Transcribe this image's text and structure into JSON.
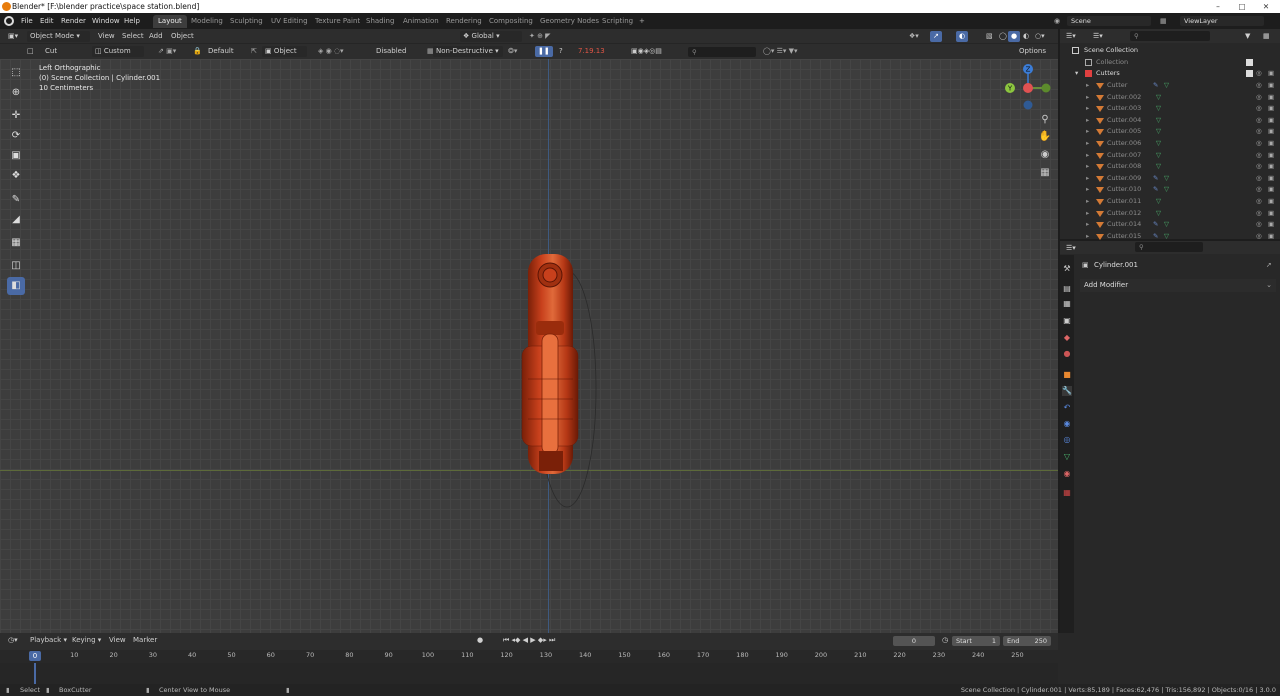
{
  "titlebar": {
    "title": "Blender* [F:\\blender practice\\space station.blend]"
  },
  "topbar": {
    "menus": [
      "File",
      "Edit",
      "Render",
      "Window",
      "Help"
    ],
    "workspaces": [
      "Layout",
      "Modeling",
      "Sculpting",
      "UV Editing",
      "Texture Paint",
      "Shading",
      "Animation",
      "Rendering",
      "Compositing",
      "Geometry Nodes",
      "Scripting"
    ],
    "active_workspace": "Layout",
    "scene": "Scene",
    "view_layer": "ViewLayer"
  },
  "viewport_header": {
    "mode": "Object Mode",
    "menus": [
      "View",
      "Select",
      "Add",
      "Object"
    ],
    "orientation": "Global"
  },
  "tool_header": {
    "tool": "Cut",
    "shape": "Custom",
    "default_label": "Default",
    "object_label": "Object",
    "disabled_label": "Disabled",
    "nondestructive": "Non-Destructive",
    "version": "7.19.13",
    "options": "Options"
  },
  "viewport": {
    "view_name": "Left Orthographic",
    "collection": "(0) Scene Collection | Cylinder.001",
    "units": "10 Centimeters",
    "gizmo": {
      "x_label": "Y",
      "z_label": "Z"
    }
  },
  "outliner": {
    "root": "Scene Collection",
    "collection": "Collection",
    "cutters": "Cutters",
    "items": [
      "Cutter",
      "Cutter.002",
      "Cutter.003",
      "Cutter.004",
      "Cutter.005",
      "Cutter.006",
      "Cutter.007",
      "Cutter.008",
      "Cutter.009",
      "Cutter.010",
      "Cutter.011",
      "Cutter.012",
      "Cutter.014",
      "Cutter.015"
    ]
  },
  "properties": {
    "object": "Cylinder.001",
    "add_modifier": "Add Modifier"
  },
  "timeline": {
    "menus": [
      "Playback",
      "Keying",
      "View",
      "Marker"
    ],
    "current_frame": "0",
    "start_label": "Start",
    "start": "1",
    "end_label": "End",
    "end": "250",
    "ticks": [
      "0",
      "10",
      "20",
      "30",
      "40",
      "50",
      "60",
      "70",
      "80",
      "90",
      "100",
      "110",
      "120",
      "130",
      "140",
      "150",
      "160",
      "170",
      "180",
      "190",
      "200",
      "210",
      "220",
      "230",
      "240",
      "250"
    ]
  },
  "statusbar": {
    "select": "Select",
    "boxcutter": "BoxCutter",
    "center_view": "Center View to Mouse",
    "stats": "Scene Collection | Cylinder.001 | Verts:85,189 | Faces:62,476 | Tris:156,892 | Objects:0/16 | 3.0.0"
  },
  "colors": {
    "accent": "#4a6aa5",
    "object": "#c8401c",
    "cutter_icon": "#d47a35",
    "modifier_icon": "#55a07a"
  }
}
